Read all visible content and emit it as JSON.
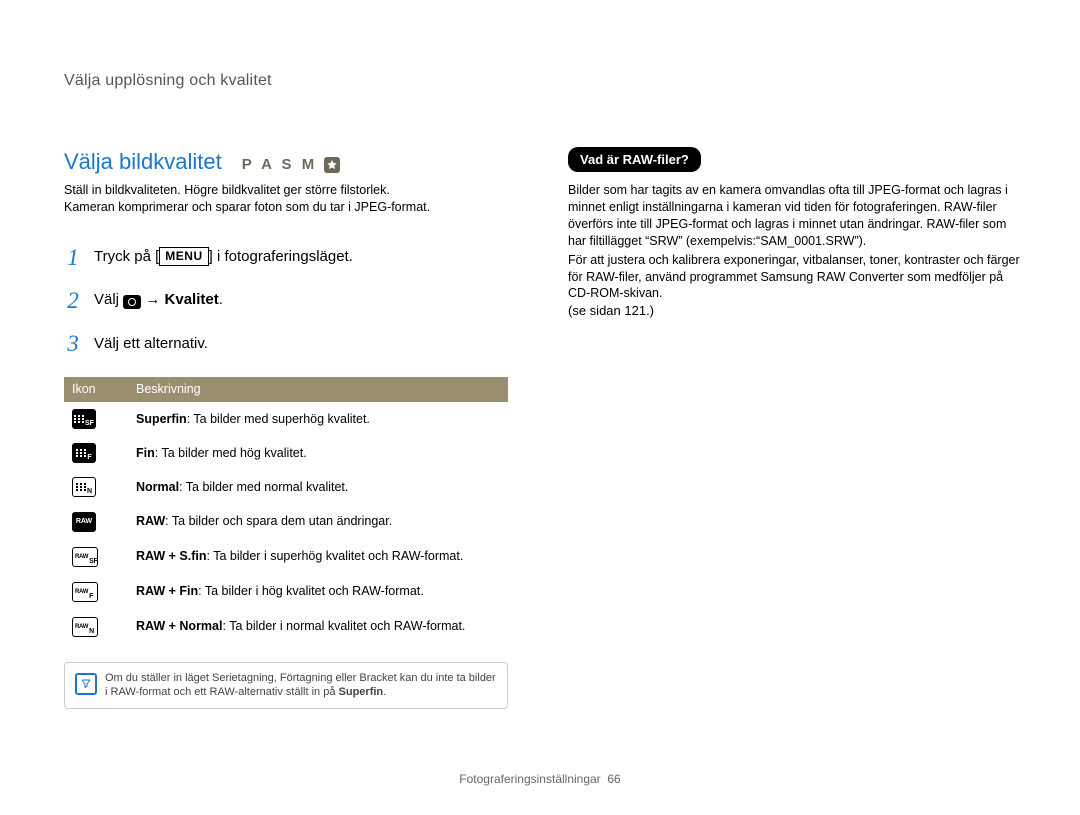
{
  "header": {
    "section_title": "Välja upplösning och kvalitet"
  },
  "left": {
    "title": "Välja bildkvalitet",
    "modes": "P A S M",
    "intro1": "Ställ in bildkvaliteten. Högre bildkvalitet ger större filstorlek.",
    "intro2": "Kameran komprimerar och sparar foton som du tar i JPEG-format.",
    "steps": {
      "s1_a": "Tryck på [",
      "s1_btn": "MENU",
      "s1_b": "] i fotograferingsläget.",
      "s2_a": "Välj ",
      "s2_arrow": "→",
      "s2_b": "Kvalitet",
      "s2_c": ".",
      "s3": "Välj ett alternativ."
    },
    "table": {
      "th_icon": "Ikon",
      "th_desc": "Beskrivning",
      "rows": [
        {
          "icon_key": "sf",
          "icon_label": "SF",
          "term": "Superfin",
          "desc": ": Ta bilder med superhög kvalitet."
        },
        {
          "icon_key": "f",
          "icon_label": "F",
          "term": "Fin",
          "desc": ": Ta bilder med hög kvalitet."
        },
        {
          "icon_key": "n",
          "icon_label": "N",
          "term": "Normal",
          "desc": ": Ta bilder med normal kvalitet."
        },
        {
          "icon_key": "raw",
          "icon_label": "RAW",
          "term": "RAW",
          "desc": ": Ta bilder och spara dem utan ändringar."
        },
        {
          "icon_key": "rsf",
          "icon_label": "SF",
          "term": "RAW + S.fin",
          "desc": ": Ta bilder i superhög kvalitet och RAW-format."
        },
        {
          "icon_key": "rf",
          "icon_label": "F",
          "term": "RAW + Fin",
          "desc": ": Ta bilder i hög kvalitet och RAW-format."
        },
        {
          "icon_key": "rn",
          "icon_label": "N",
          "term": "RAW + Normal",
          "desc": ": Ta bilder i normal kvalitet och RAW-format."
        }
      ]
    },
    "note_a": "Om du ställer in läget Serietagning, Förtagning eller Bracket kan du inte ta bilder i RAW-format och ett RAW-alternativ ställt in på ",
    "note_b": "Superfin",
    "note_c": "."
  },
  "right": {
    "pill": "Vad är RAW-filer?",
    "p1": "Bilder som har tagits av en kamera omvandlas ofta till JPEG-format och lagras i minnet enligt inställningarna i kameran vid tiden för fotograferingen. RAW-filer överförs inte till JPEG-format och lagras i minnet utan ändringar. RAW-filer som har filtillägget “SRW” (exempelvis:“SAM_0001.SRW”).",
    "p2": "För att justera och kalibrera exponeringar, vitbalanser, toner, kontraster och färger för RAW-filer, använd programmet Samsung RAW Converter som medföljer på CD-ROM-skivan.",
    "p3": "(se sidan 121.)"
  },
  "footer": {
    "section": "Fotograferingsinställningar",
    "page": "66"
  }
}
